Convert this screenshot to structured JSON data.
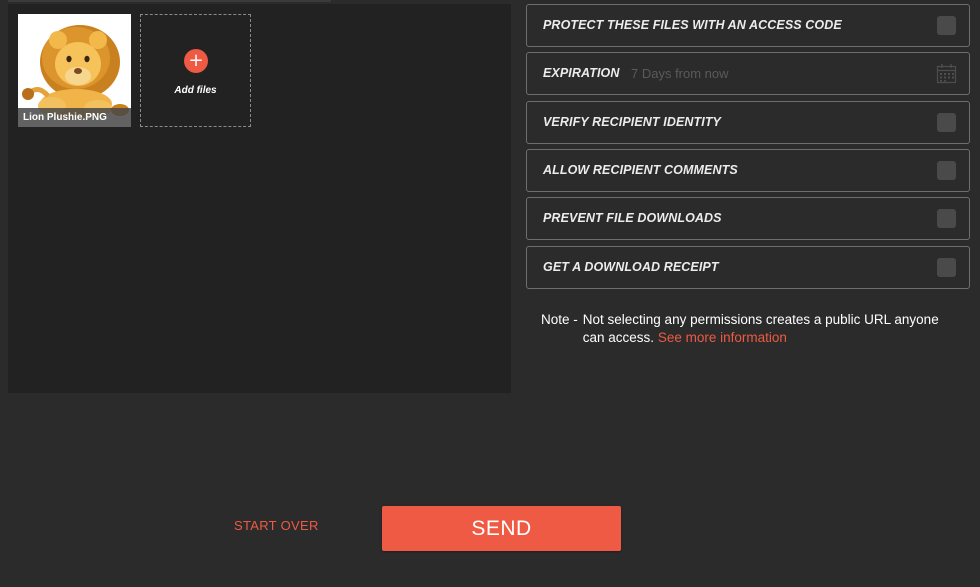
{
  "files": [
    {
      "name": "Lion Plushie.PNG",
      "thumbnail": "lion-plush-image"
    }
  ],
  "add_files": {
    "label": "Add files",
    "icon": "plus-icon"
  },
  "permissions": [
    {
      "label": "PROTECT THESE FILES WITH AN ACCESS CODE",
      "checked": false
    },
    {
      "label": "EXPIRATION",
      "value": "7 Days from now",
      "icon": "calendar-icon"
    },
    {
      "label": "VERIFY RECIPIENT IDENTITY",
      "checked": false
    },
    {
      "label": "ALLOW RECIPIENT COMMENTS",
      "checked": false
    },
    {
      "label": "PREVENT FILE DOWNLOADS",
      "checked": false
    },
    {
      "label": "GET A DOWNLOAD RECEIPT",
      "checked": false
    }
  ],
  "note": {
    "prefix": "Note -",
    "text": "Not selecting any permissions creates a public URL anyone can access.",
    "link": "See more information"
  },
  "actions": {
    "start_over": "START OVER",
    "send": "SEND"
  },
  "colors": {
    "accent": "#ee5a43",
    "background": "#2b2b2b",
    "panel": "#222222"
  }
}
